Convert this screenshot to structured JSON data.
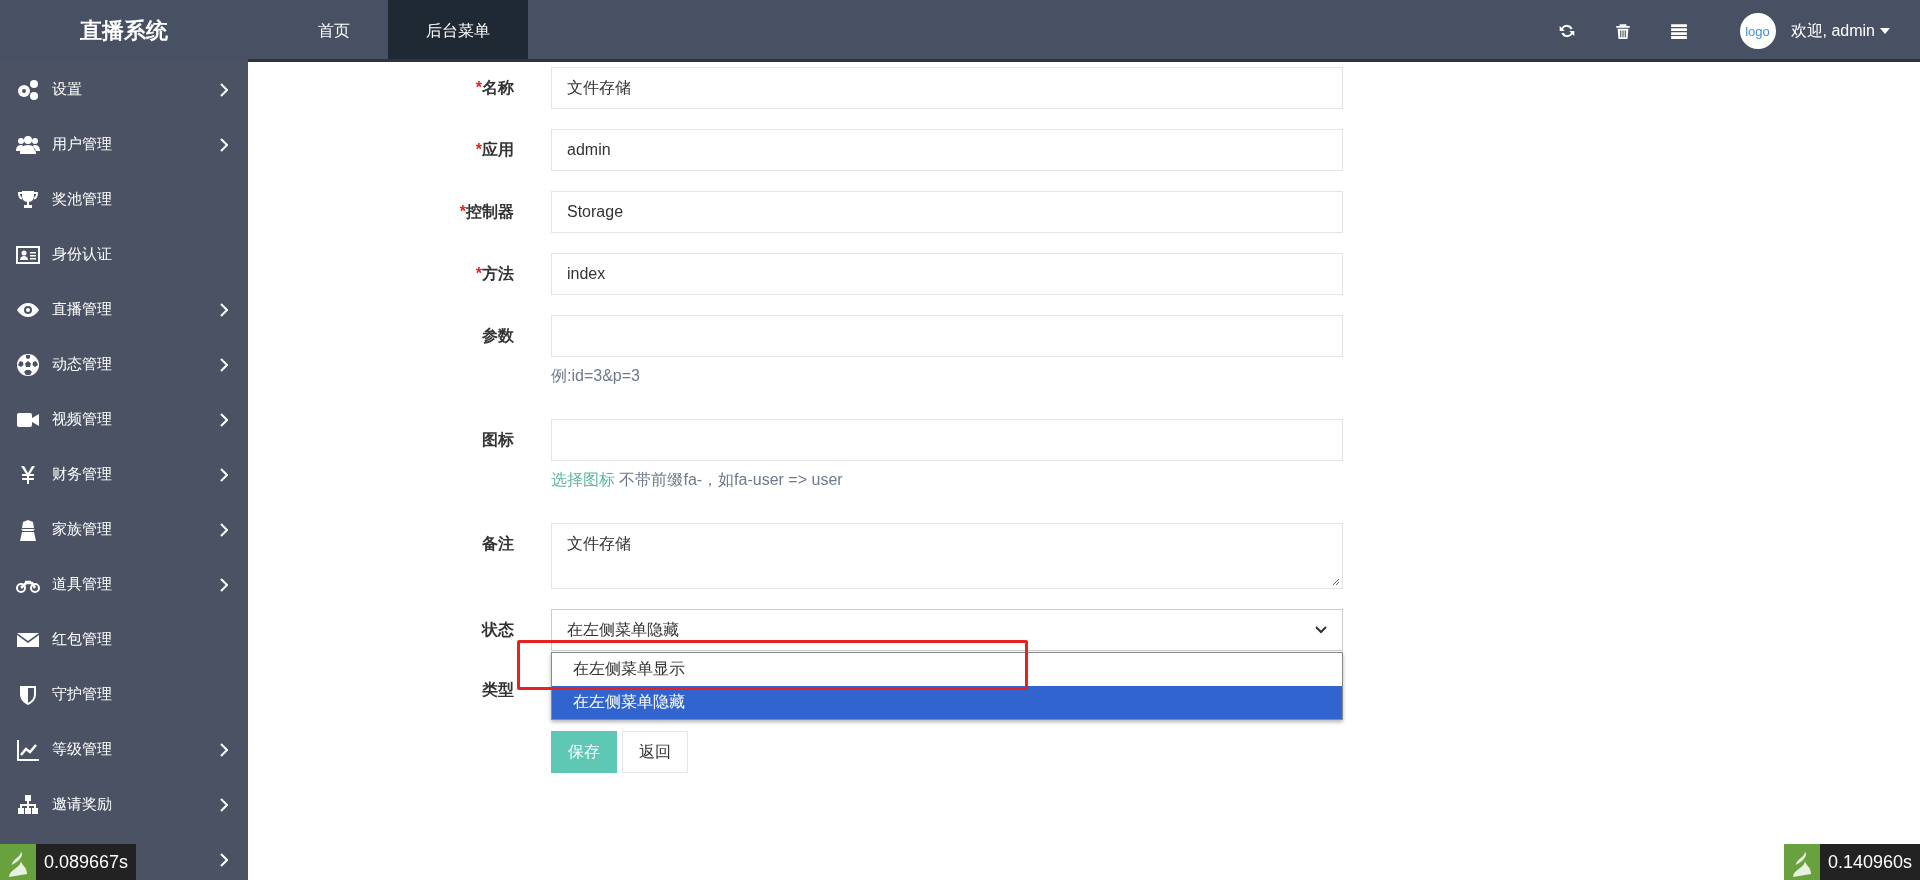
{
  "brand": "直播系统",
  "nav_tabs": [
    {
      "label": "首页",
      "selected": false
    },
    {
      "label": "后台菜单",
      "selected": true
    }
  ],
  "user": {
    "avatar_text": "logo",
    "greeting": "欢迎, admin"
  },
  "sidebar": {
    "items": [
      {
        "label": "设置",
        "has_children": true
      },
      {
        "label": "用户管理",
        "has_children": true
      },
      {
        "label": "奖池管理",
        "has_children": false
      },
      {
        "label": "身份认证",
        "has_children": false
      },
      {
        "label": "直播管理",
        "has_children": true
      },
      {
        "label": "动态管理",
        "has_children": true
      },
      {
        "label": "视频管理",
        "has_children": true
      },
      {
        "label": "财务管理",
        "has_children": true
      },
      {
        "label": "家族管理",
        "has_children": true
      },
      {
        "label": "道具管理",
        "has_children": true
      },
      {
        "label": "红包管理",
        "has_children": false
      },
      {
        "label": "守护管理",
        "has_children": false
      },
      {
        "label": "等级管理",
        "has_children": true
      },
      {
        "label": "邀请奖励",
        "has_children": true
      },
      {
        "has_children": true
      }
    ]
  },
  "form": {
    "fields": [
      {
        "kind": "input",
        "required_mark": "*",
        "label": "名称",
        "value": "文件存储"
      },
      {
        "kind": "input",
        "required_mark": "*",
        "label": "应用",
        "value": "admin"
      },
      {
        "kind": "input",
        "required_mark": "*",
        "label": "控制器",
        "value": "Storage"
      },
      {
        "kind": "input",
        "required_mark": "*",
        "label": "方法",
        "value": "index"
      },
      {
        "kind": "input",
        "label": "参数",
        "help": "例:id=3&p=3"
      },
      {
        "kind": "input",
        "label": "图标",
        "help_link": "选择图标",
        "help": "不带前缀fa-，如fa-user => user"
      },
      {
        "kind": "textarea",
        "label": "备注",
        "value": "文件存储"
      },
      {
        "kind": "select",
        "label": "状态",
        "value": "在左侧菜单隐藏",
        "expanded": true,
        "options": [
          {
            "label": "在左侧菜单显示",
            "selected": false
          },
          {
            "label": "在左侧菜单隐藏",
            "selected": true
          }
        ]
      },
      {
        "kind": "covered",
        "label": "类型"
      }
    ],
    "buttons": [
      {
        "label": "保存",
        "kind": "primary"
      },
      {
        "label": "返回",
        "kind": "default"
      }
    ]
  },
  "debug_timers": [
    {
      "value": "0.089667s"
    },
    {
      "value": "0.140960s"
    }
  ]
}
